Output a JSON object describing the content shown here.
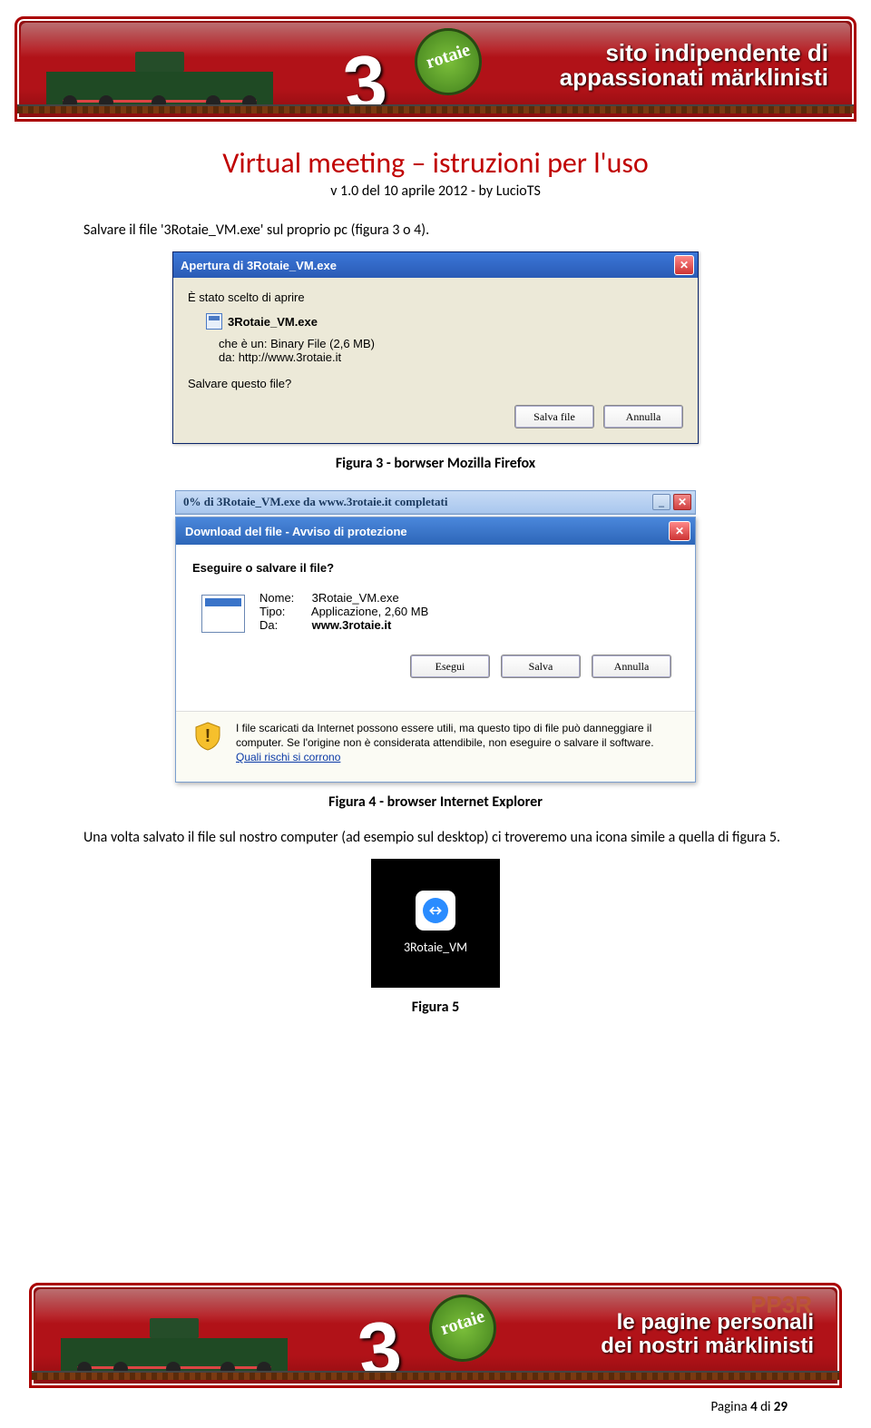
{
  "banner_top": {
    "tagline_l1": "sito indipendente di",
    "tagline_l2": "appassionati märklinisti",
    "brand_num": "3",
    "brand_word": "rotaie"
  },
  "banner_bottom": {
    "pp": "PP3R",
    "l1": "le pagine personali",
    "l2": "dei nostri märklinisti",
    "brand_num": "3",
    "brand_word": "rotaie"
  },
  "title": "Virtual meeting – istruzioni per l'uso",
  "subtitle": "v 1.0 del 10 aprile 2012 -  by LucioTS",
  "intro": "Salvare il file '3Rotaie_VM.exe' sul proprio pc  (figura 3 o 4).",
  "fig3_caption": "Figura 3 - borwser Mozilla Firefox",
  "fig4_caption": "Figura 4 - browser Internet Explorer",
  "para2": "Una volta salvato il file sul nostro computer (ad esempio sul desktop) ci troveremo una icona simile a quella di figura 5.",
  "fig5_caption": "Figura 5",
  "ff": {
    "title": "Apertura di 3Rotaie_VM.exe",
    "line1": "È stato scelto di aprire",
    "filename": "3Rotaie_VM.exe",
    "type_label": "che è un:",
    "type_val": "Binary File (2,6 MB)",
    "from_label": "da:",
    "from_val": "http://www.3rotaie.it",
    "question": "Salvare questo file?",
    "btn_save": "Salva file",
    "btn_cancel": "Annulla"
  },
  "ieprog": {
    "title": "0% di 3Rotaie_VM.exe da www.3rotaie.it completati"
  },
  "ie": {
    "title": "Download del file - Avviso di protezione",
    "question": "Eseguire o salvare il file?",
    "name_k": "Nome:",
    "name_v": "3Rotaie_VM.exe",
    "type_k": "Tipo:",
    "type_v": "Applicazione, 2,60 MB",
    "from_k": "Da:",
    "from_v": "www.3rotaie.it",
    "btn_run": "Esegui",
    "btn_save": "Salva",
    "btn_cancel": "Annulla",
    "warn": "I file scaricati da Internet possono essere utili, ma questo tipo di file può danneggiare il computer. Se l'origine non è considerata attendibile, non eseguire o salvare il software. ",
    "warn_link": "Quali rischi si corrono"
  },
  "tv_label": "3Rotaie_VM",
  "footer": {
    "pre": "Pagina ",
    "cur": "4",
    "mid": " di ",
    "tot": "29"
  }
}
